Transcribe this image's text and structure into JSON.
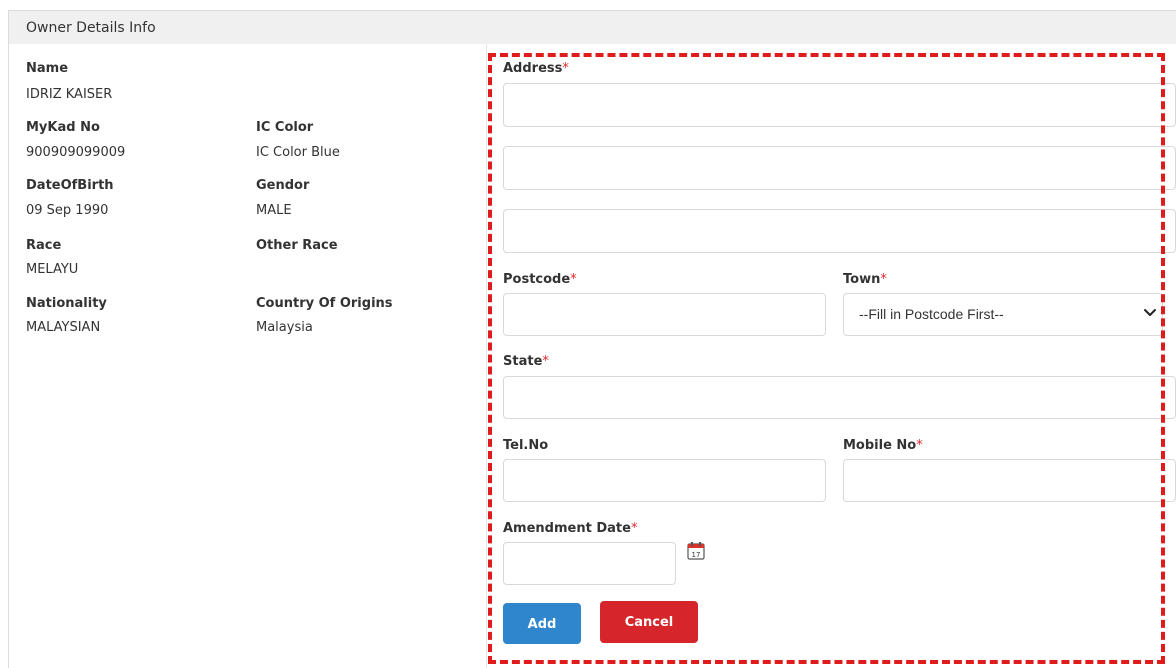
{
  "panel": {
    "title": "Owner Details Info"
  },
  "owner": {
    "name_label": "Name",
    "name": "IDRIZ KAISER",
    "mykad_label": "MyKad No",
    "mykad": "900909099009",
    "ic_color_label": "IC Color",
    "ic_color": "IC Color Blue",
    "dob_label": "DateOfBirth",
    "dob": "09 Sep 1990",
    "gender_label": "Gendor",
    "gender": "MALE",
    "race_label": "Race",
    "race": "MELAYU",
    "other_race_label": "Other Race",
    "other_race": "",
    "nationality_label": "Nationality",
    "nationality": "MALAYSIAN",
    "country_label": "Country Of Origins",
    "country": "Malaysia"
  },
  "form": {
    "address_label": "Address",
    "address_line1": "",
    "address_line2": "",
    "address_line3": "",
    "postcode_label": "Postcode",
    "postcode": "",
    "town_label": "Town",
    "town_selected": "--Fill in Postcode First--",
    "state_label": "State",
    "state": "",
    "tel_label": "Tel.No",
    "tel": "",
    "mobile_label": "Mobile No",
    "mobile": "",
    "amendment_label": "Amendment Date",
    "amendment": "",
    "required_mark": "*",
    "calendar_day": "17",
    "add_label": "Add",
    "cancel_label": "Cancel"
  },
  "icons": {
    "calendar": "calendar-icon",
    "chevron": "chevron-down-icon"
  },
  "colors": {
    "required": "#e0262a",
    "add_button": "#2f86cc",
    "cancel_button": "#d6262b",
    "highlight_border": "#e01b1b"
  }
}
